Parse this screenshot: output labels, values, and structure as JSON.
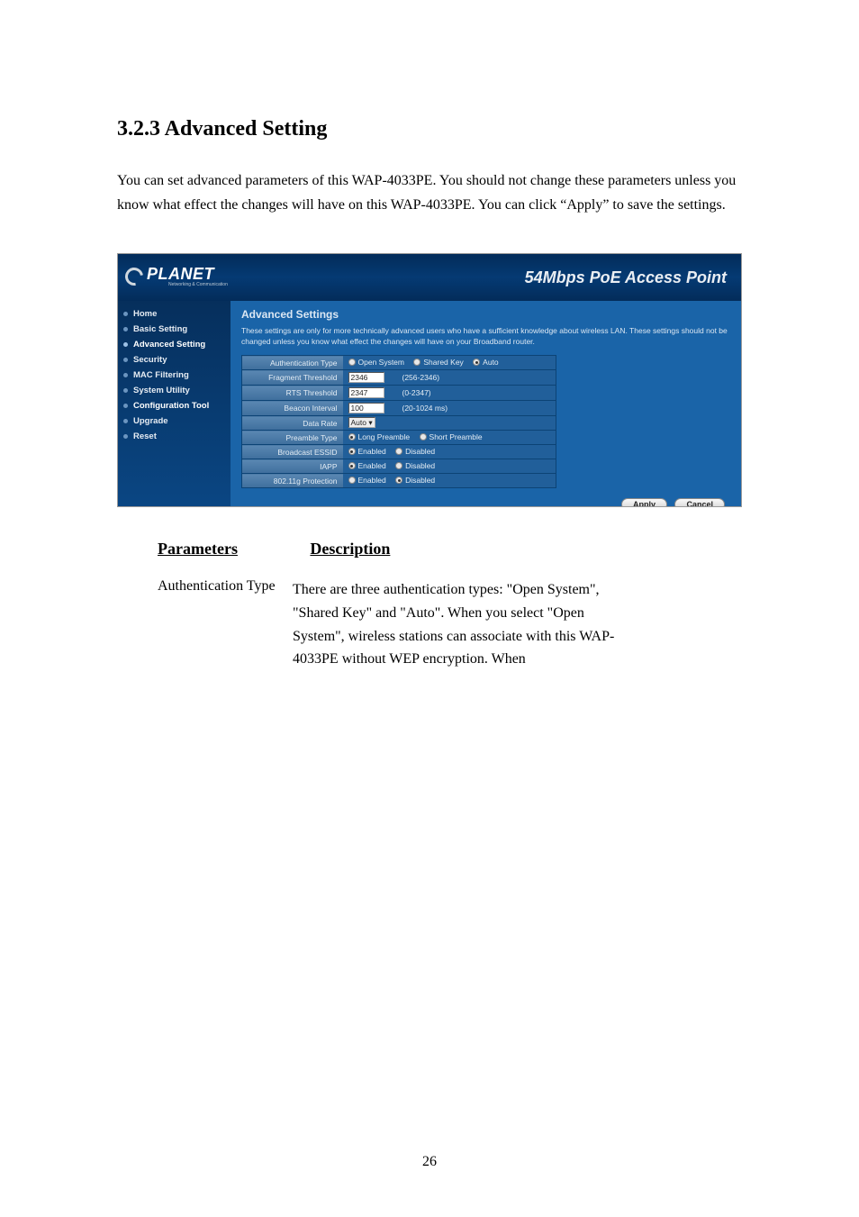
{
  "doc": {
    "section_num": "3.2.3 Advanced Setting",
    "section_text": "You can set advanced parameters of this WAP-4033PE. You should not change these parameters unless you know what effect the changes will have on this WAP-4033PE. You can click “Apply” to save the settings."
  },
  "header": {
    "logo_text": "PLANET",
    "logo_sub": "Networking & Communication",
    "product_title": "54Mbps PoE Access Point"
  },
  "sidebar": {
    "items": [
      "Home",
      "Basic Setting",
      "Advanced Setting",
      "Security",
      "MAC Filtering",
      "System Utility",
      "Configuration Tool",
      "Upgrade",
      "Reset"
    ]
  },
  "main": {
    "title": "Advanced Settings",
    "desc": "These settings are only for more technically advanced users who have a sufficient knowledge about wireless LAN. These settings should not be changed unless you know what effect the changes will have on your Broadband router.",
    "rows": {
      "auth_label": "Authentication Type",
      "auth_open": "Open System",
      "auth_shared": "Shared Key",
      "auth_auto": "Auto",
      "frag_label": "Fragment Threshold",
      "frag_value": "2346",
      "frag_range": "(256-2346)",
      "rts_label": "RTS Threshold",
      "rts_value": "2347",
      "rts_range": "(0-2347)",
      "beacon_label": "Beacon Interval",
      "beacon_value": "100",
      "beacon_range": "(20-1024 ms)",
      "rate_label": "Data Rate",
      "rate_value": "Auto",
      "preamble_label": "Preamble Type",
      "preamble_long": "Long Preamble",
      "preamble_short": "Short Preamble",
      "essid_label": "Broadcast ESSID",
      "enabled": "Enabled",
      "disabled": "Disabled",
      "iapp_label": "IAPP",
      "protection_label": "802.11g Protection"
    },
    "buttons": {
      "apply": "Apply",
      "cancel": "Cancel"
    }
  },
  "table_header": {
    "param": "Parameters",
    "desc": "Description"
  },
  "table_row": {
    "label": "Authentication Type",
    "desc": "There are three authentication types: \"Open System\", \"Shared Key\" and \"Auto\". When you select \"Open System\", wireless stations can associate with this WAP-4033PE without WEP encryption. When"
  },
  "pagenum": "26"
}
